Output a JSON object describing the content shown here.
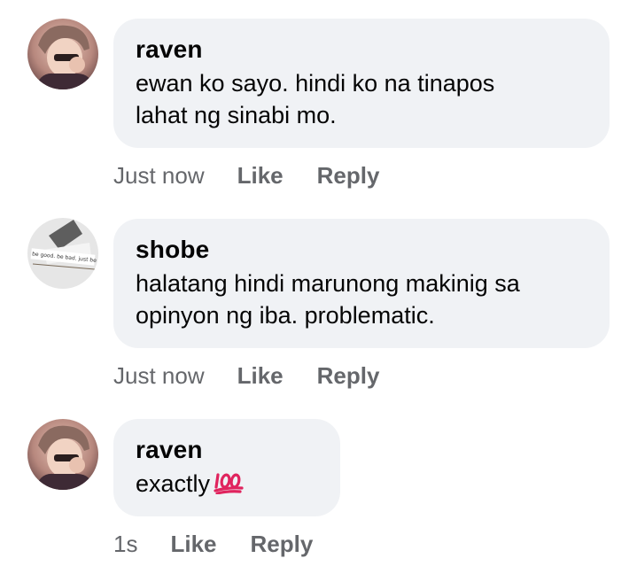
{
  "comments": [
    {
      "author": "raven",
      "text": "ewan ko sayo. hindi ko na tinapos lahat ng sinabi mo.",
      "line1": "ewan ko sayo. hindi ko na tinapos",
      "line2": "lahat ng sinabi mo.",
      "time": "Just now",
      "like_label": "Like",
      "reply_label": "Reply"
    },
    {
      "author": "shobe",
      "text": "halatang hindi marunong makinig sa opinyon ng iba. problematic.",
      "line1": "halatang hindi marunong makinig sa",
      "line2": "opinyon ng iba. problematic.",
      "time": "Just now",
      "like_label": "Like",
      "reply_label": "Reply",
      "avatar_caption": "be good. be bad. just be"
    },
    {
      "author": "raven",
      "text": "exactly",
      "time": "1s",
      "like_label": "Like",
      "reply_label": "Reply",
      "emoji": "hundred-points-emoji"
    }
  ],
  "colors": {
    "bubble": "#f0f2f5",
    "text": "#050505",
    "meta": "#65676b",
    "emoji": "#e0245e"
  }
}
